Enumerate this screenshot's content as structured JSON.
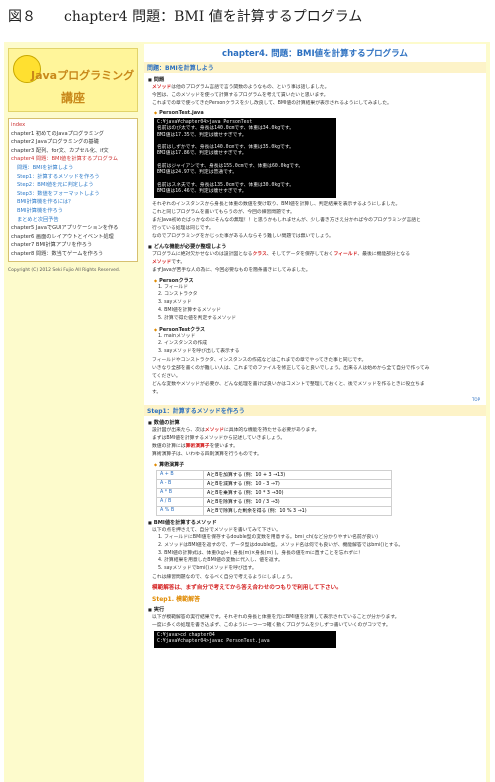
{
  "figure_caption": "図８　　chapter4 問題：BMI 値を計算するプログラム",
  "logo": {
    "title": "Javaプログラミング",
    "subtitle": "講座"
  },
  "nav": {
    "items": [
      {
        "label": "index",
        "type": "chap"
      },
      {
        "label": "chapter1 初めてのJavaプログラミング",
        "type": "plain"
      },
      {
        "label": "chapter2 Javaプログラミングの基礎",
        "type": "plain"
      },
      {
        "label": "chapter3 配列、for文、カプセル化、if文",
        "type": "plain"
      },
      {
        "label": "chapter4 問題：BMI値を計算するプログラム",
        "type": "sel"
      },
      {
        "label": "問題：BMIを計算しよう",
        "type": "sub"
      },
      {
        "label": "Step1：計算するメソッドを作ろう",
        "type": "sub"
      },
      {
        "label": "Step2：BMI値を元に判定しよう",
        "type": "sub"
      },
      {
        "label": "Step3：数値をフォーマットしよう",
        "type": "sub"
      },
      {
        "label": "BMI計算機を作るには？",
        "type": "sub"
      },
      {
        "label": "BMI計算機を作ろう",
        "type": "sub"
      },
      {
        "label": "まとめと次回予告",
        "type": "sub"
      },
      {
        "label": "chapter5 JavaでGUIアプリケーションを作る",
        "type": "plain"
      },
      {
        "label": "chapter6 画面のレイアウトとイベント処理",
        "type": "plain"
      },
      {
        "label": "chapter7 BMI計算アプリを作ろう",
        "type": "plain"
      },
      {
        "label": "chapter8 問題：数当てゲームを作ろう",
        "type": "plain"
      }
    ]
  },
  "copyright": "Copyright (C) 2012 Seki Fujio All Rights Reserved.",
  "main": {
    "title": "chapter4. 問題：BMI値を計算するプログラム",
    "sec1": "問題：BMIを計算しよう",
    "h_problem": "問題",
    "p1a": "メソッド",
    "p1b": "は他のプログラム言語で言う関数のようなもの、という事は話しました。",
    "p2": "今回は、このメソッドを使って計算するプログラムを考えて貰いたいと思います。",
    "p3": "これまでの章で使ってきたPersonクラスを少し改良して、BMI値の計算結果が表示されるようにしてみました。",
    "sub_person_test": "PersonTest.java",
    "terminal1": "C:¥java¥chapter04>java PersonTest\n名前はのび太です、身長は140.0cmです、体重は34.0kgです。\nBMI値は17.35で、判定は痩せすぎです。\n\n名前はしずかです、身長は140.0cmです、体重は35.0kgです。\nBMI値は17.86で、判定は痩せすぎです。\n\n名前はジャイアンです、身長は155.0cmです、体重は60.0kgです。\nBMI値は24.97で、判定は普通です。\n\n名前はスネ夫です、身長は135.0cmです、体重は30.0kgです。\nBMI値は16.46で、判定は痩せすぎです。",
    "p4": "それぞれのインスタンスから身長と体重の数値を受け取り、BMI値を計算し、判定結果を表示するようにしました。",
    "p5": "これと同じプログラムを書いてもらうのが、今回の練習問題です。",
    "p6": "まだJava初めたばっかなのにそんなの無理！！と思うかもしれませんが、少し書き方さえ分かれば今のプログラミング言語と",
    "p7": "行っている処理は同じです。",
    "p8": "なのでプログラミングをかじった事がある人ならそう難しい問題では無いでしょう。",
    "h_need": "どんな機能が必要か整理しよう",
    "p9a": "プログラムに絶対欠かせないのは設計図となる",
    "p9b": "クラス",
    "p9c": "、そしてデータを保存しておく",
    "p9d": "フィールド",
    "p9e": "、最後に機能部分となる",
    "p10a": "メソッド",
    "p10b": "です。",
    "p11": "まずJavaが苦手な人の為に、今回必要なものを簡条書きにしてみました。",
    "sub_person": "Personクラス",
    "person_list": [
      "1. フィールド",
      "2. コンストラクタ",
      "3. sayメソッド",
      "4. BMI値を計算するメソッド",
      "5. 計算で得た値を判定するメソッド"
    ],
    "sub_person_test2": "PersonTestクラス",
    "person_test_list": [
      "1. mainメソッド",
      "2. インスタンスの作成",
      "3. sayメソッドを呼び出して表示する"
    ],
    "p12": "フィールドやコンストラクタ、インスタンスの作成などはこれまでの章でやってきた事と同じです。",
    "p13": "いきなり全部を書くのが難しい人は、これまでのファイルを修正してると良いでしょう。出来る人は始めから全て自分で作ってみ",
    "p14": "てください。",
    "p15": "どんな変数やメソッドが必要か、どんな処理を書けば良いかはコメントで整理しておくと、後でメソッドを作るときに役立ちま",
    "p16": "す。",
    "top_link": "TOP",
    "sec2": "Step1：計算するメソッドを作ろう",
    "h_calc": "数値の計算",
    "p17a": "設計図が出来たら、次は",
    "p17b": "メソッド",
    "p17c": "に具体的な機能を持たせる必要があります。",
    "p18": "まずはBMI値を計算するメソッドから記述していきましょう。",
    "p19": "数値の計算には",
    "p19b": "算術演算子",
    "p19c": "を使います。",
    "p20": "算術演算子は、いわゆる四則演算を行うものです。",
    "sub_ops": "算術演算子",
    "ops": [
      [
        "A + B",
        "AとBを加算する (例：10 + 3 →13)"
      ],
      [
        "A - B",
        "AとBを減算する (例：10 - 3 →7)"
      ],
      [
        "A * B",
        "AとBを乗算する (例：10 * 3 →30)"
      ],
      [
        "A / B",
        "AとBを除算する (例：10 / 3 →3)"
      ],
      [
        "A % B",
        "AとBで除算した剰余を得る (例：10 % 3 →1)"
      ]
    ],
    "h_bmi": "BMI値を計算するメソッド",
    "p21": "以下の点を押さえて、自分でメソッドを書いてみて下さい。",
    "bmi_list": [
      "1. フィールドにBMI値を保存するdouble型の変数を用意する。bmi_ch(など分かりやすい名前が良い)",
      "2. メソッドはBMI値を返すので、データ型はdouble型。メソッド名は何でも良いが、機能解答ではbmi()とする。",
      "3. BMI値の計算式は、体重(kg)÷( 身長(m)×身長(m) )。身長の値をmに直すことを忘れずに！",
      "4. 計算結果を用意したBMI値の変数に代入し、値を返す。",
      "5. sayメソッドでbmi()メソッドを呼び出す。"
    ],
    "p22": "これは練習問題なので、なるべく自分で考えるようにしましょう。",
    "p23": "模範解答は、まず自分で考えてから答え合わせのつもりで利用して下さい。",
    "step1_answer": "Step1. 模範解答",
    "h_run": "実行",
    "p24": "以下が模範解答の実行結果です。それぞれの身長と体重を元にBMI値を計算して表示されていることが分かります。",
    "p25": "一度に多くの処理を書き込まず、このように一つ一つ確く動くプログラムを少しずつ書いていくのがコツです。",
    "terminal2": "C:¥java>cd chapter04\nC:¥java¥chapter04>javac PersonTest.java"
  }
}
